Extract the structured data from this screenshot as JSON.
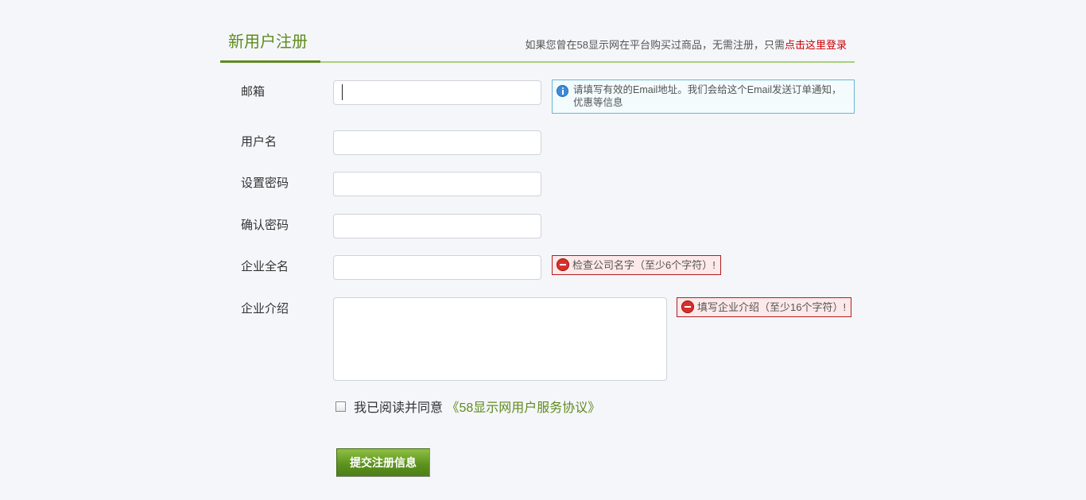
{
  "header": {
    "title": "新用户注册",
    "login_hint_prefix": "如果您曾在58显示网在平台购买过商品，无需注册，只需",
    "login_link": "点击这里登录"
  },
  "form": {
    "email": {
      "label": "邮箱",
      "value": "",
      "tip": "请填写有效的Email地址。我们会给这个Email发送订单通知，优惠等信息"
    },
    "username": {
      "label": "用户名",
      "value": ""
    },
    "password": {
      "label": "设置密码",
      "value": ""
    },
    "confirm_password": {
      "label": "确认密码",
      "value": ""
    },
    "company_name": {
      "label": "企业全名",
      "value": "",
      "error": "检查公司名字（至少6个字符）!"
    },
    "company_intro": {
      "label": "企业介绍",
      "value": "",
      "error": "填写企业介绍（至少16个字符）!"
    },
    "agreement": {
      "checked": false,
      "text": "我已阅读并同意",
      "link": "《58显示网用户服务协议》"
    },
    "submit_label": "提交注册信息"
  },
  "colors": {
    "accent": "#5e8b1e",
    "link_red": "#cc0000",
    "info_border": "#6ab7d3",
    "error_border": "#b21e1e"
  },
  "icons": {
    "tip_info": "info-icon",
    "tip_error": "stop-icon"
  }
}
